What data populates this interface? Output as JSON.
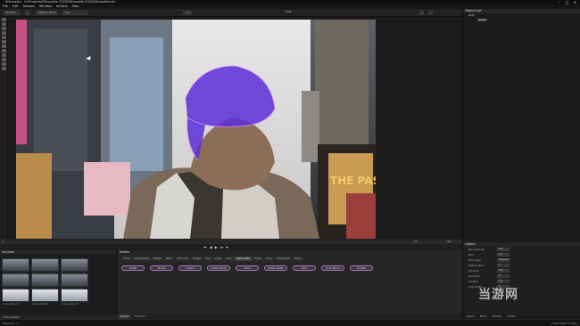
{
  "window": {
    "title": "Silhouette - H:/Projects/Silhouette 2020/Silhouette 2020/Silhouette.sfx"
  },
  "menu": [
    "File",
    "Edit",
    "Session",
    "Window",
    "Actions",
    "Help"
  ],
  "toolbar": {
    "layer_select": "Node 1",
    "view_select": "Mattes: Normal",
    "quality_select": "Full",
    "zoom": "1:1",
    "frame_label": "RGB"
  },
  "timeline": {
    "start": "1",
    "end": "100",
    "current": "50"
  },
  "playback": [
    "⏮",
    "◀",
    "▶",
    "⏭",
    "⏺"
  ],
  "sources": {
    "title": "Sources",
    "footer": "Scale Viewer",
    "thumbs": [
      "timesquare_plate_01",
      "timesquare_plate_02",
      "timesquare_plate_03",
      "timesquare_roto_01",
      "timesquare_roto_02",
      "timesquare_roto_03",
      "snow_plate_01",
      "snow_plate_02",
      "snow_plate_03"
    ]
  },
  "nodes": {
    "title": "Nodes",
    "tabs": [
      "Color",
      "Composite",
      "Filters",
      "Paint",
      "Film Lab",
      "Image",
      "Key",
      "Light",
      "Roto",
      "Silhouette",
      "Time",
      "Tools",
      "Transform",
      "Warp"
    ],
    "active_tab": "Silhouette",
    "buttons": [
      "Depth",
      "Morph",
      "Output",
      "Output Multi",
      "Paint",
      "Power Matte",
      "Roto",
      "Roto Blend",
      "Zmatte"
    ],
    "footer_tabs": [
      "Nodes",
      "Trackers"
    ]
  },
  "objectlist": {
    "title": "Object List",
    "root": "Roto",
    "shape_tag": "Shape1"
  },
  "inspector": {
    "title": "Object",
    "rows": [
      {
        "label": "Blend Mode",
        "value": "Add"
      },
      {
        "label": "Blur",
        "value": "1.0"
      },
      {
        "label": "Blur Type",
        "value": "Gaussian"
      },
      {
        "label": "Motion Blur",
        "value": "0"
      },
      {
        "label": "Opacity",
        "value": "100"
      },
      {
        "label": "Samples",
        "value": "8"
      },
      {
        "label": "Shutter",
        "value": "0.5"
      },
      {
        "label": "Cap Width",
        "value": "0"
      }
    ],
    "tabs": [
      "Object",
      "Node",
      "Presets",
      "Notes"
    ]
  },
  "status": {
    "left": "Playback: 1",
    "right": "1920x1080  24.0fps"
  },
  "watermark": "当游网",
  "colors": {
    "matte": "#5a2fd8",
    "accent": "#b46fd0"
  }
}
